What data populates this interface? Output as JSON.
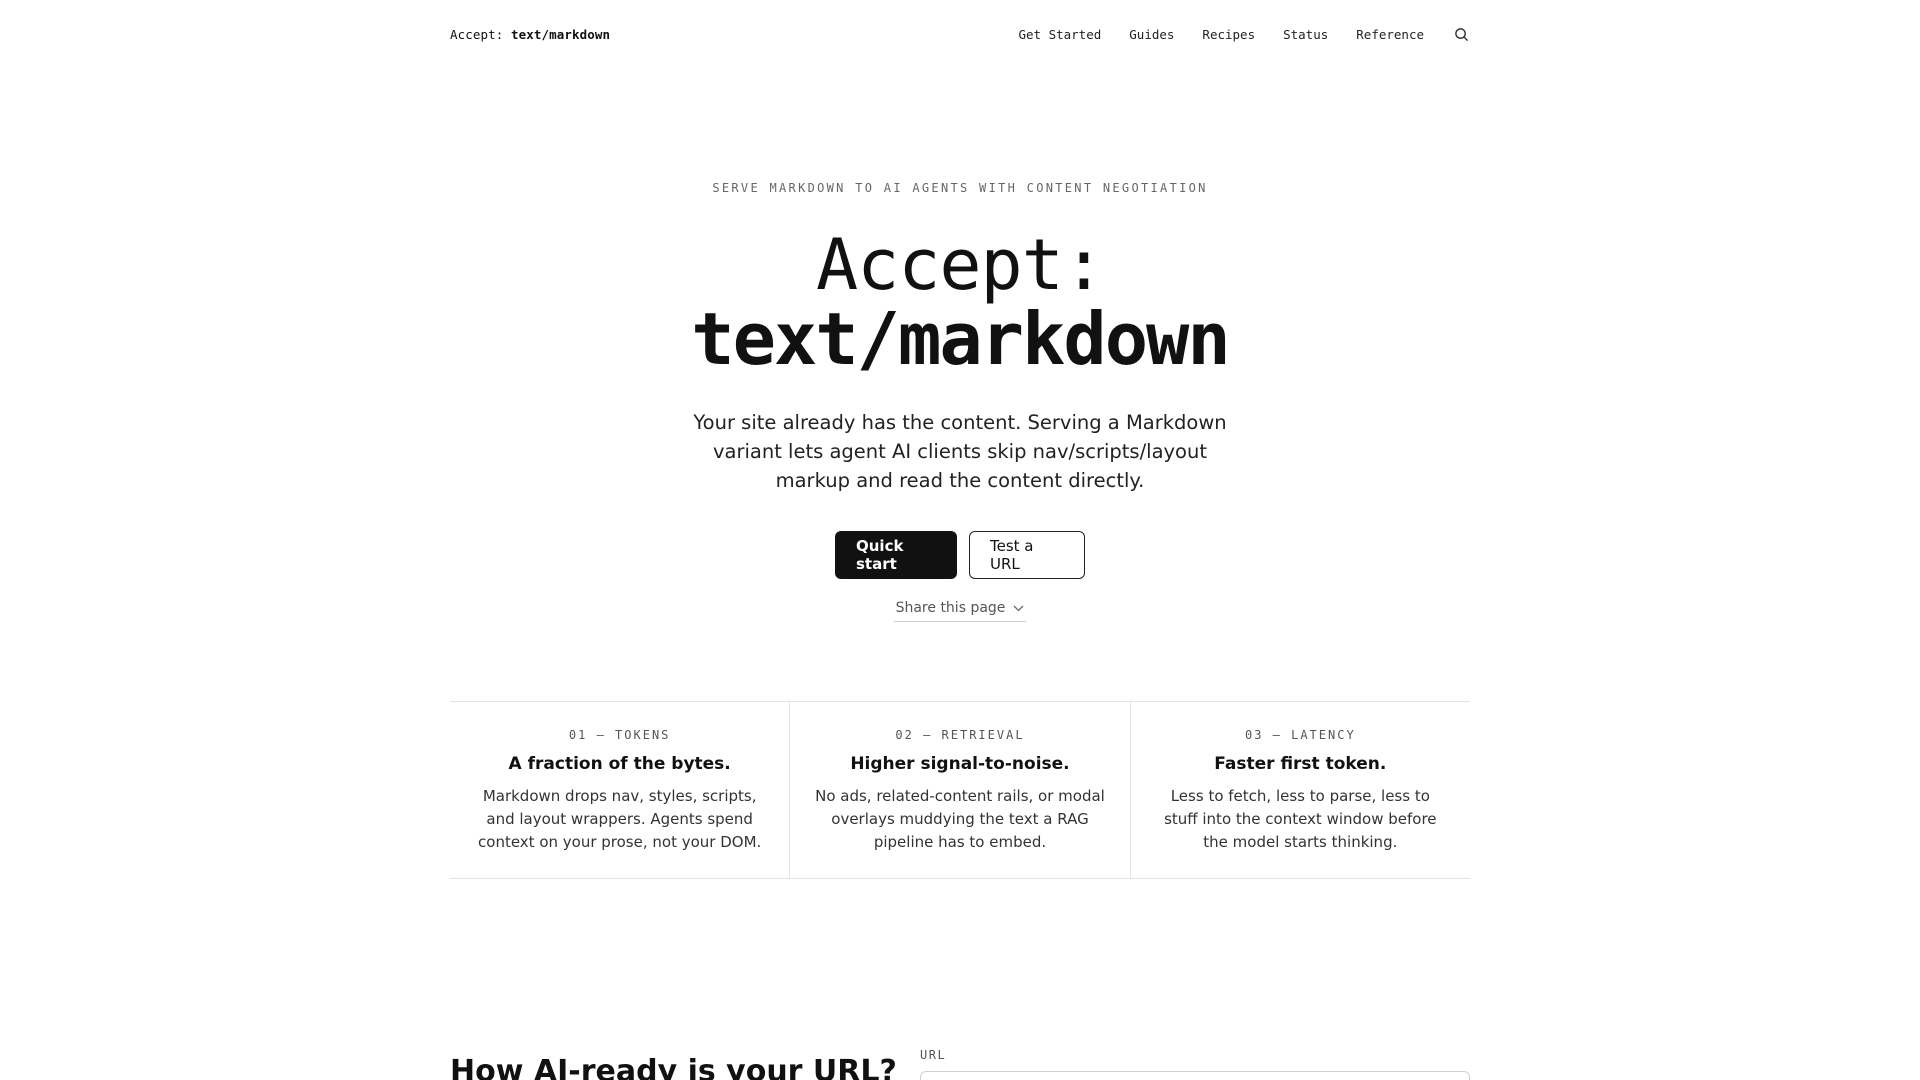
{
  "header": {
    "brand_prefix": "Accept:",
    "brand_value": "text/markdown",
    "nav": [
      {
        "label": "Get Started"
      },
      {
        "label": "Guides"
      },
      {
        "label": "Recipes"
      },
      {
        "label": "Status"
      },
      {
        "label": "Reference"
      }
    ],
    "search_icon": "search-icon"
  },
  "hero": {
    "eyebrow": "SERVE MARKDOWN TO AI AGENTS WITH CONTENT NEGOTIATION",
    "title_line1": "Accept:",
    "title_line2": "text/markdown",
    "lead": "Your site already has the content. Serving a Markdown variant lets agent AI clients skip nav/scripts/layout markup and read the content directly.",
    "primary_cta": "Quick start",
    "secondary_cta": "Test a URL",
    "share_label": "Share this page",
    "share_icon": "chevron-down-icon"
  },
  "features": [
    {
      "num": "01 — TOKENS",
      "title": "A fraction of the bytes.",
      "body": "Markdown drops nav, styles, scripts, and layout wrappers. Agents spend context on your prose, not your DOM."
    },
    {
      "num": "02 — RETRIEVAL",
      "title": "Higher signal-to-noise.",
      "body": "No ads, related-content rails, or modal overlays muddying the text a RAG pipeline has to embed."
    },
    {
      "num": "03 — LATENCY",
      "title": "Faster first token.",
      "body": "Less to fetch, less to parse, less to stuff into the context window before the model starts thinking."
    }
  ],
  "tester": {
    "title": "How AI-ready is your URL?",
    "url_label": "URL",
    "url_value": ""
  }
}
